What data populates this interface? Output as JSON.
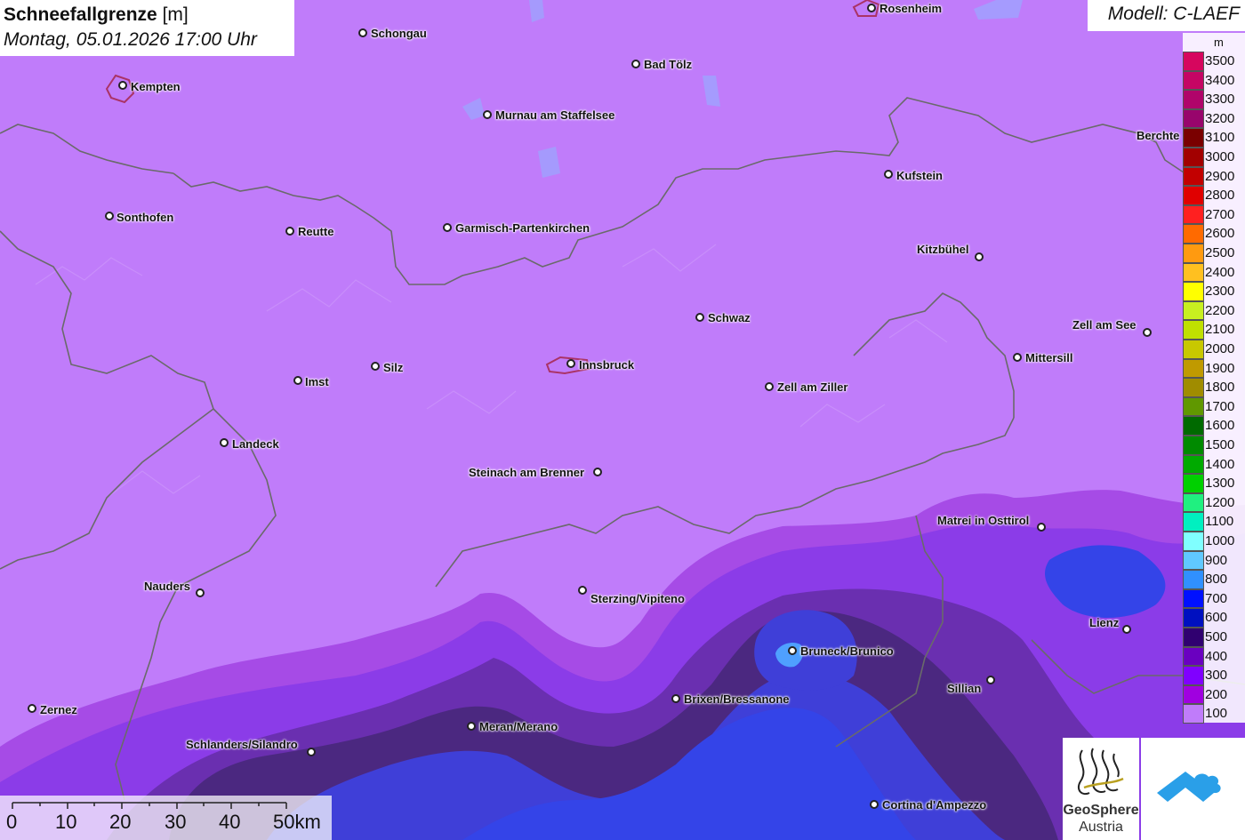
{
  "header": {
    "title": "Schneefallgrenze",
    "unit": "[m]",
    "subtitle": "Montag, 05.01.2026 17:00 Uhr"
  },
  "model": "Modell: C-LAEF",
  "legend": {
    "unit": "m",
    "items": [
      {
        "label": "3500",
        "color": "#d6065e"
      },
      {
        "label": "3400",
        "color": "#c50564"
      },
      {
        "label": "3300",
        "color": "#b0046a"
      },
      {
        "label": "3200",
        "color": "#98056c"
      },
      {
        "label": "3100",
        "color": "#7a0000"
      },
      {
        "label": "3000",
        "color": "#a20000"
      },
      {
        "label": "2900",
        "color": "#c20000"
      },
      {
        "label": "2800",
        "color": "#e00000"
      },
      {
        "label": "2700",
        "color": "#ff2020"
      },
      {
        "label": "2600",
        "color": "#ff6a00"
      },
      {
        "label": "2500",
        "color": "#ff9a10"
      },
      {
        "label": "2400",
        "color": "#ffc020"
      },
      {
        "label": "2300",
        "color": "#ffff00"
      },
      {
        "label": "2200",
        "color": "#c8f020"
      },
      {
        "label": "2100",
        "color": "#c0e000"
      },
      {
        "label": "2000",
        "color": "#c8c800"
      },
      {
        "label": "1900",
        "color": "#c09a00"
      },
      {
        "label": "1800",
        "color": "#a08c00"
      },
      {
        "label": "1700",
        "color": "#609800"
      },
      {
        "label": "1600",
        "color": "#006a00"
      },
      {
        "label": "1500",
        "color": "#008a00"
      },
      {
        "label": "1400",
        "color": "#00aa00"
      },
      {
        "label": "1300",
        "color": "#00d000"
      },
      {
        "label": "1200",
        "color": "#20f080"
      },
      {
        "label": "1100",
        "color": "#00f0c0"
      },
      {
        "label": "1000",
        "color": "#80ffff"
      },
      {
        "label": "900",
        "color": "#60c8ff"
      },
      {
        "label": "800",
        "color": "#3090ff"
      },
      {
        "label": "700",
        "color": "#0010ff"
      },
      {
        "label": "600",
        "color": "#0010c0"
      },
      {
        "label": "500",
        "color": "#300070"
      },
      {
        "label": "400",
        "color": "#6a00c0"
      },
      {
        "label": "300",
        "color": "#8000ff"
      },
      {
        "label": "200",
        "color": "#a000e0"
      },
      {
        "label": "100",
        "color": "#c07cfa"
      }
    ]
  },
  "cities": [
    {
      "name": "Rosenheim",
      "dot": [
        980,
        9
      ],
      "label": [
        989,
        2
      ]
    },
    {
      "name": "Schongau",
      "dot": [
        408,
        37
      ],
      "label": [
        417,
        30
      ]
    },
    {
      "name": "Bad Tölz",
      "dot": [
        715,
        72
      ],
      "label": [
        724,
        65
      ]
    },
    {
      "name": "Kempten",
      "dot": [
        138,
        96
      ],
      "label": [
        147,
        90
      ]
    },
    {
      "name": "Murnau am Staffelsee",
      "dot": [
        548,
        129
      ],
      "label": [
        557,
        122
      ]
    },
    {
      "name": "Berchte",
      "dot": null,
      "label": [
        1278,
        145
      ]
    },
    {
      "name": "Kufstein",
      "dot": [
        999,
        196
      ],
      "label": [
        1008,
        190
      ]
    },
    {
      "name": "Sonthofen",
      "dot": [
        123,
        243
      ],
      "label": [
        131,
        237
      ]
    },
    {
      "name": "Reutte",
      "dot": [
        326,
        260
      ],
      "label": [
        335,
        253
      ]
    },
    {
      "name": "Garmisch-Partenkirchen",
      "dot": [
        503,
        256
      ],
      "label": [
        512,
        249
      ]
    },
    {
      "name": "Kitzbühel",
      "dot": [
        1101,
        289
      ],
      "label": [
        1031,
        273
      ]
    },
    {
      "name": "Schwaz",
      "dot": [
        787,
        357
      ],
      "label": [
        796,
        350
      ]
    },
    {
      "name": "Zell am See",
      "dot": [
        1290,
        374
      ],
      "label": [
        1206,
        358
      ]
    },
    {
      "name": "Mittersill",
      "dot": [
        1144,
        402
      ],
      "label": [
        1153,
        395
      ]
    },
    {
      "name": "Silz",
      "dot": [
        422,
        412
      ],
      "label": [
        431,
        406
      ]
    },
    {
      "name": "Innsbruck",
      "dot": [
        642,
        409
      ],
      "label": [
        651,
        403
      ]
    },
    {
      "name": "Imst",
      "dot": [
        335,
        428
      ],
      "label": [
        343,
        422
      ]
    },
    {
      "name": "Zell am Ziller",
      "dot": [
        865,
        435
      ],
      "label": [
        874,
        428
      ]
    },
    {
      "name": "Landeck",
      "dot": [
        252,
        498
      ],
      "label": [
        261,
        492
      ]
    },
    {
      "name": "Steinach am Brenner",
      "dot": [
        672,
        531
      ],
      "label": [
        527,
        524
      ]
    },
    {
      "name": "Matrei in Osttirol",
      "dot": [
        1171,
        593
      ],
      "label": [
        1054,
        578
      ]
    },
    {
      "name": "Nauders",
      "dot": [
        225,
        667
      ],
      "label": [
        162,
        652
      ]
    },
    {
      "name": "Sterzing/Vipiteno",
      "dot": [
        655,
        664
      ],
      "label": [
        664,
        666
      ]
    },
    {
      "name": "Lienz",
      "dot": [
        1267,
        708
      ],
      "label": [
        1225,
        693
      ]
    },
    {
      "name": "Bruneck/Brunico",
      "dot": [
        891,
        732
      ],
      "label": [
        900,
        725
      ]
    },
    {
      "name": "Sillian",
      "dot": [
        1114,
        765
      ],
      "label": [
        1065,
        767
      ]
    },
    {
      "name": "Brixen/Bressanone",
      "dot": [
        760,
        786
      ],
      "label": [
        769,
        779
      ]
    },
    {
      "name": "Zernez",
      "dot": [
        36,
        797
      ],
      "label": [
        45,
        791
      ]
    },
    {
      "name": "Meran/Merano",
      "dot": [
        530,
        817
      ],
      "label": [
        539,
        810
      ]
    },
    {
      "name": "Schlanders/Silandro",
      "dot": [
        350,
        846
      ],
      "label": [
        209,
        830
      ]
    },
    {
      "name": "Cortina d'Ampezzo",
      "dot": [
        983,
        905
      ],
      "label": [
        992,
        898
      ]
    }
  ],
  "scalebar": {
    "labels": [
      "0",
      "10",
      "20",
      "30",
      "40",
      "50km"
    ]
  },
  "logos": {
    "geosphere_line1": "GeoSphere",
    "geosphere_line2": "Austria"
  },
  "colors": {
    "base": "#c07cfa",
    "band_200": "#a64be6",
    "band_300": "#8b3ce8",
    "band_400": "#6a2fb0",
    "band_500": "#4b2880",
    "band_600": "#3f3fd8",
    "band_700": "#3444e8",
    "band_800": "#4fa0ff",
    "border": "#6a6a6a",
    "water": "#9aa8ff"
  }
}
